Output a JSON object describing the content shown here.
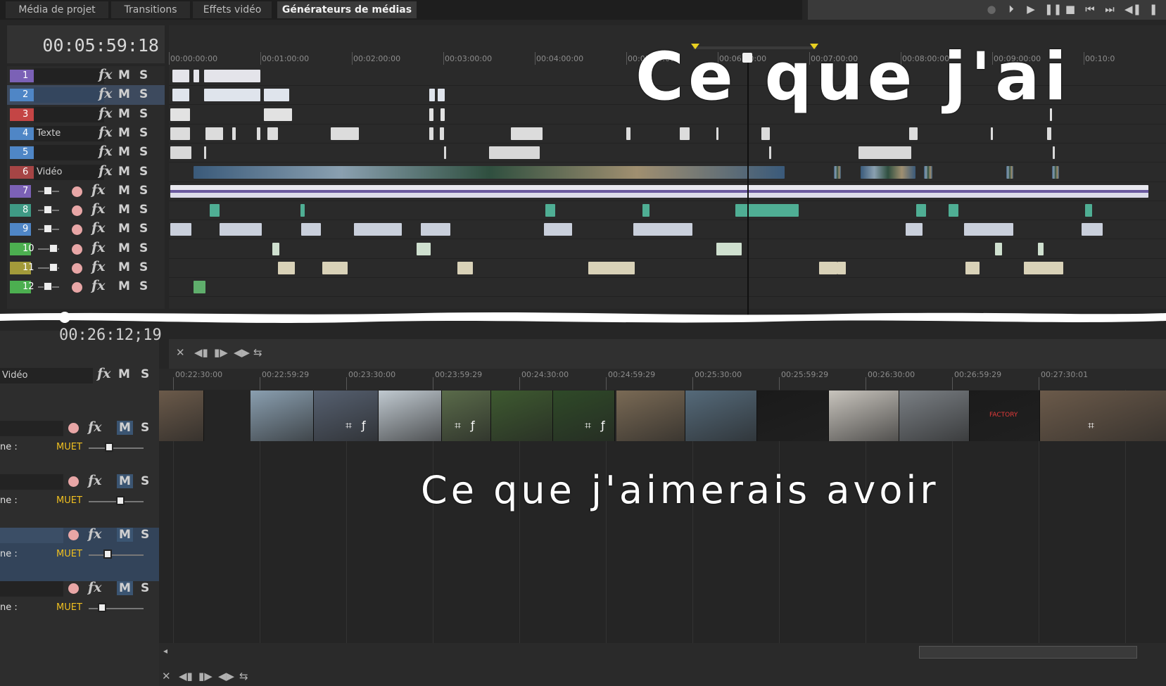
{
  "tabs": [
    {
      "label": "Média de projet",
      "active": false
    },
    {
      "label": "Transitions",
      "active": false
    },
    {
      "label": "Effets vidéo",
      "active": false
    },
    {
      "label": "Générateurs de médias",
      "active": true
    }
  ],
  "upper": {
    "timecode": "00:05:59:18",
    "ruler_labels": [
      "00:00:00:00",
      "00:01:00:00",
      "00:02:00:00",
      "00:03:00:00",
      "00:04:00:00",
      "00:05:00:00",
      "00:06:00:00",
      "00:07:00:00",
      "00:08:00:00",
      "00:09:00:00",
      "00:10:0"
    ],
    "video_tracks": [
      {
        "num": "1",
        "name": "",
        "color": "#7b61b6"
      },
      {
        "num": "2",
        "name": "",
        "color": "#4f86c6",
        "selected": true
      },
      {
        "num": "3",
        "name": "",
        "color": "#c44545"
      },
      {
        "num": "4",
        "name": "Texte",
        "color": "#4f86c6"
      },
      {
        "num": "5",
        "name": "",
        "color": "#4f86c6"
      },
      {
        "num": "6",
        "name": "Vidéo",
        "color": "#a64545"
      }
    ],
    "audio_tracks": [
      {
        "num": "7",
        "color": "#7b61b6"
      },
      {
        "num": "8",
        "color": "#3f9a85"
      },
      {
        "num": "9",
        "color": "#4f86c6"
      },
      {
        "num": "10",
        "color": "#4caf50"
      },
      {
        "num": "11",
        "color": "#a39a3a"
      },
      {
        "num": "12",
        "color": "#4caf50"
      }
    ],
    "fx_label": "fx",
    "mute_label": "M",
    "solo_label": "S"
  },
  "caption_top": "Ce que j'ai",
  "lower": {
    "timecode": "00:26:12;19",
    "ruler_labels": [
      "00:22:30:00",
      "00:22:59:29",
      "00:23:30:00",
      "00:23:59:29",
      "00:24:30:00",
      "00:24:59:29",
      "00:25:30:00",
      "00:25:59:29",
      "00:26:30:00",
      "00:26:59:29",
      "00:27:30:01"
    ],
    "video_track_name": "Vidéo",
    "audio_tracks": [
      {
        "vol_label": "ne :",
        "muet": "MUET",
        "selected": false
      },
      {
        "vol_label": "ne :",
        "muet": "MUET",
        "selected": false
      },
      {
        "vol_label": "ne :",
        "muet": "MUET",
        "selected": true
      },
      {
        "vol_label": "ne :",
        "muet": "MUET",
        "selected": false
      }
    ],
    "thumbnail_colors": [
      "#6b5a4a",
      "#8a9fb0",
      "#566070",
      "#c0c9d0",
      "#5a6b4a",
      "#3e5a30",
      "#2f4a28",
      "#7a6a55",
      "#556a7a",
      "#1a1a1a",
      "#c8c4bd",
      "#7a7f84",
      "#1b1b1b"
    ],
    "factory_text": "FACTORY"
  },
  "caption_bottom": "Ce que j'aimerais avoir"
}
